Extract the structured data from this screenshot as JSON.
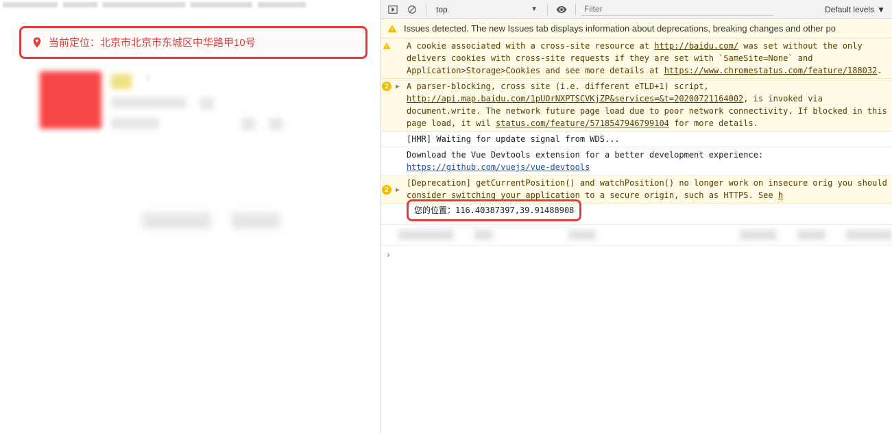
{
  "app": {
    "location_label_prefix": "当前定位：",
    "location_address": "北京市北京市东城区中华路甲10号"
  },
  "devtools": {
    "toolbar": {
      "context": "top",
      "filter_placeholder": "Filter",
      "levels_label": "Default levels"
    },
    "issues_bar": "Issues detected. The new Issues tab displays information about deprecations, breaking changes and other po",
    "logs": {
      "cookie_warn_pre": "A cookie associated with a cross-site resource at ",
      "cookie_warn_link1": "http://baidu.com/",
      "cookie_warn_mid": " was set without the only delivers cookies with cross-site requests if they are set with `SameSite=None` and Application>Storage>Cookies and see more details at ",
      "cookie_warn_link2": "https://www.chromestatus.com/feature/188032",
      "cookie_warn_end": ".",
      "parser_warn_pre": "A parser-blocking, cross site (i.e. different eTLD+1) script, ",
      "parser_warn_link1": "http://api.map.baidu.com/1pUOrNXPTSCVKjZP&services=&t=20200721164002",
      "parser_warn_mid": ", is invoked via document.write. The network future page load due to poor network connectivity. If blocked in this page load, it wil ",
      "parser_warn_link2": "status.com/feature/5718547946799104",
      "parser_warn_end": " for more details.",
      "parser_badge": "2",
      "hmr": "[HMR] Waiting for update signal from WDS...",
      "vue_pre": "Download the Vue Devtools extension for a better development experience:",
      "vue_link": "https://github.com/vuejs/vue-devtools",
      "deprecation_badge": "2",
      "deprecation_pre": "[Deprecation] getCurrentPosition() and watchPosition() no longer work on insecure orig ",
      "deprecation_mid": "you should consider switching your application to a secure origin, such as HTTPS. See ",
      "deprecation_link": "h",
      "position_output": "您的位置：116.40387397,39.91488908"
    }
  }
}
